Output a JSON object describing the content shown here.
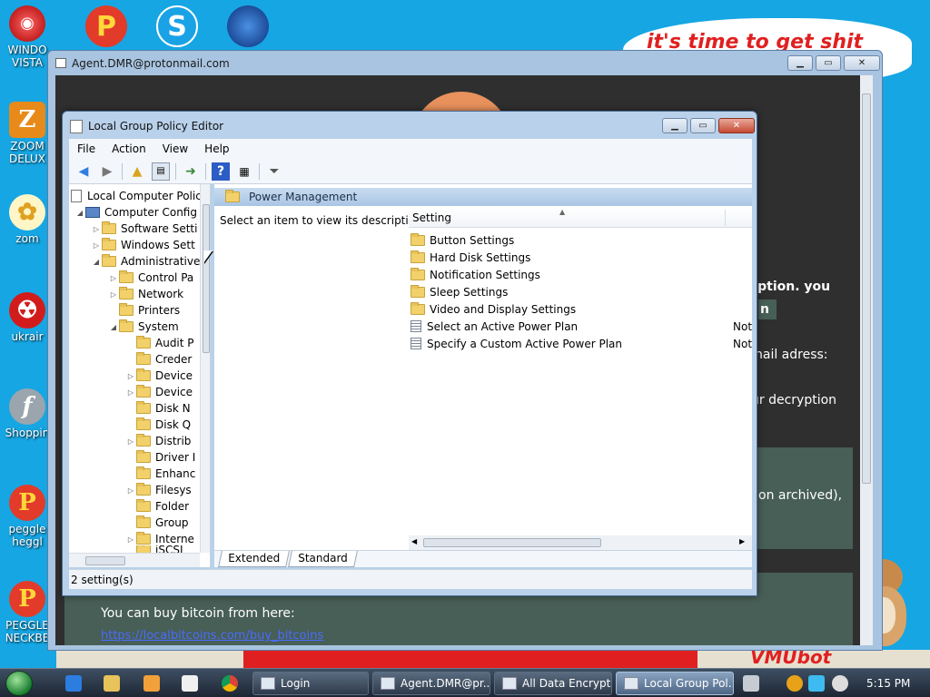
{
  "desktop": {
    "icons": [
      {
        "label": "WINDO VISTA"
      },
      {
        "label": "ZOOM DELUX"
      },
      {
        "label": "zom"
      },
      {
        "label": "ukrair"
      },
      {
        "label": "Shoppin"
      },
      {
        "label": "peggle heggl"
      },
      {
        "label": "PEGGLE NECKBE"
      }
    ],
    "top_icons": [
      {
        "glyph": "P"
      },
      {
        "glyph": "S"
      }
    ],
    "banner_text": "it's time to get shit",
    "banner_bottom_text": "VMUbot"
  },
  "agent_window": {
    "title": "Agent.DMR@protonmail.com",
    "note": {
      "line1": "yption. you",
      "line2": "n",
      "line3": "nail adress:",
      "line4": "ur decryption",
      "line5": "on archived),",
      "bitcoin_text": "You can buy bitcoin from here:",
      "bitcoin_link": "https://localbitcoins.com/buy_bitcoins"
    }
  },
  "gpe": {
    "title": "Local Group Policy Editor",
    "menu": [
      "File",
      "Action",
      "View",
      "Help"
    ],
    "tree": [
      {
        "label": "Local Computer Polic"
      },
      {
        "label": "Computer Config"
      },
      {
        "label": "Software Setti"
      },
      {
        "label": "Windows Sett"
      },
      {
        "label": "Administrative"
      },
      {
        "label": "Control Pa"
      },
      {
        "label": "Network"
      },
      {
        "label": "Printers"
      },
      {
        "label": "System"
      },
      {
        "label": "Audit P"
      },
      {
        "label": "Creder"
      },
      {
        "label": "Device"
      },
      {
        "label": "Device"
      },
      {
        "label": "Disk N"
      },
      {
        "label": "Disk Q"
      },
      {
        "label": "Distrib"
      },
      {
        "label": "Driver I"
      },
      {
        "label": "Enhanc"
      },
      {
        "label": "Filesys"
      },
      {
        "label": "Folder"
      },
      {
        "label": "Group"
      },
      {
        "label": "Interne"
      },
      {
        "label": "iSCSI"
      }
    ],
    "section_title": "Power Management",
    "description": "Select an item to view its description.",
    "column_setting": "Setting",
    "settings": [
      {
        "label": "Button Settings",
        "state": ""
      },
      {
        "label": "Hard Disk Settings",
        "state": ""
      },
      {
        "label": "Notification Settings",
        "state": ""
      },
      {
        "label": "Sleep Settings",
        "state": ""
      },
      {
        "label": "Video and Display Settings",
        "state": ""
      },
      {
        "label": "Select an Active Power Plan",
        "state": "Not"
      },
      {
        "label": "Specify a Custom Active Power Plan",
        "state": "Not"
      }
    ],
    "tabs": [
      "Extended",
      "Standard"
    ],
    "status": "2 setting(s)"
  },
  "taskbar": {
    "buttons": [
      {
        "label": "Login"
      },
      {
        "label": "Agent.DMR@pr..."
      },
      {
        "label": "All Data Encrypt..."
      },
      {
        "label": "Local Group Pol..."
      }
    ],
    "clock": "5:15 PM"
  },
  "colors": {
    "desktop": "#16a6e3",
    "note_panel": "#475f56",
    "accent": "#4c6c96"
  }
}
